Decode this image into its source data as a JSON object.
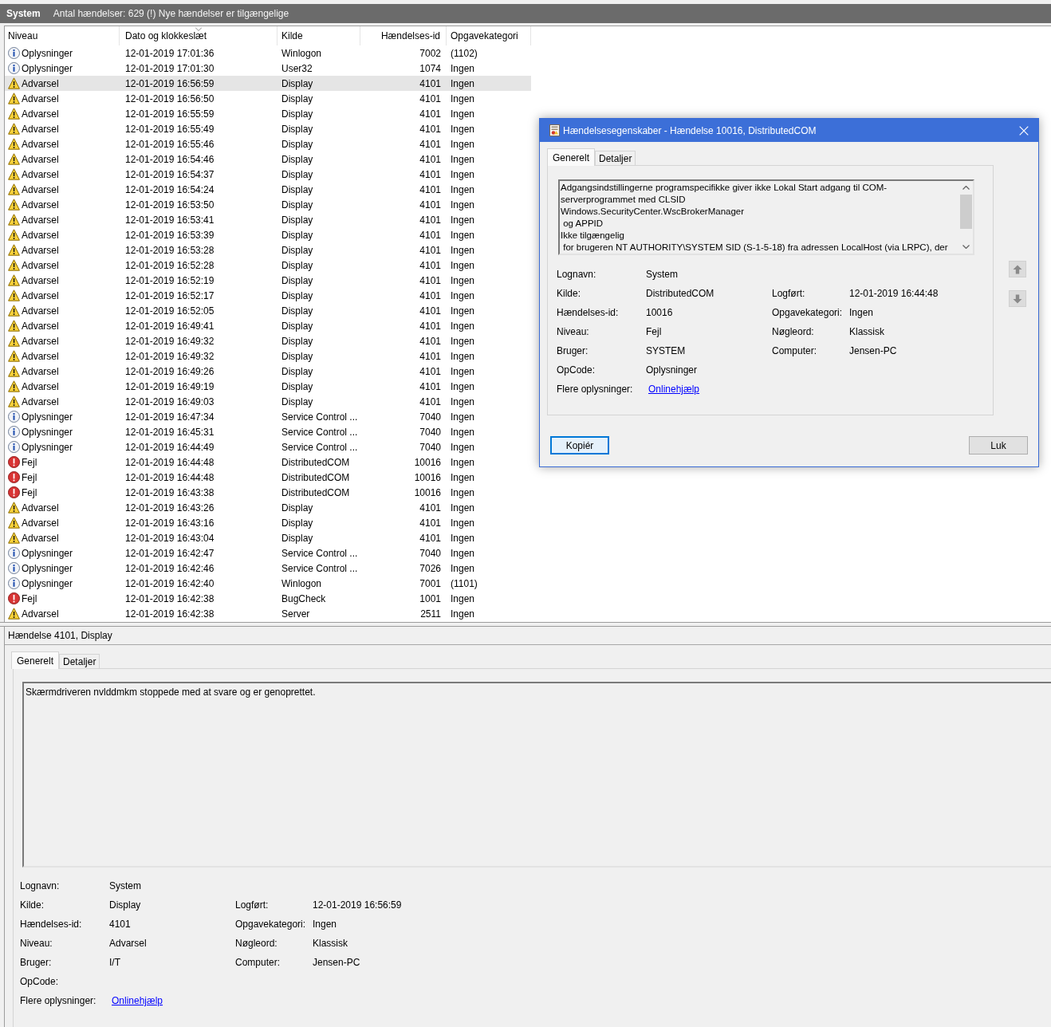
{
  "header_bar": {
    "title": "System",
    "summary": "Antal hændelser: 629 (!) Nye hændelser er tilgængelige"
  },
  "table": {
    "columns": [
      {
        "label": "Niveau",
        "sorted": false
      },
      {
        "label": "Dato og klokkeslæt",
        "sorted": true
      },
      {
        "label": "Kilde",
        "sorted": false
      },
      {
        "label": "Hændelses-id",
        "sorted": false
      },
      {
        "label": "Opgavekategori",
        "sorted": false
      }
    ],
    "rows": [
      {
        "kind": "info",
        "severity": "Oplysninger",
        "date": "12-01-2019 17:01:36",
        "source": "Winlogon",
        "event_id": "7002",
        "task_category": "(1102)",
        "selected": false
      },
      {
        "kind": "info",
        "severity": "Oplysninger",
        "date": "12-01-2019 17:01:30",
        "source": "User32",
        "event_id": "1074",
        "task_category": "Ingen",
        "selected": false
      },
      {
        "kind": "warning",
        "severity": "Advarsel",
        "date": "12-01-2019 16:56:59",
        "source": "Display",
        "event_id": "4101",
        "task_category": "Ingen",
        "selected": true
      },
      {
        "kind": "warning",
        "severity": "Advarsel",
        "date": "12-01-2019 16:56:50",
        "source": "Display",
        "event_id": "4101",
        "task_category": "Ingen",
        "selected": false
      },
      {
        "kind": "warning",
        "severity": "Advarsel",
        "date": "12-01-2019 16:55:59",
        "source": "Display",
        "event_id": "4101",
        "task_category": "Ingen",
        "selected": false
      },
      {
        "kind": "warning",
        "severity": "Advarsel",
        "date": "12-01-2019 16:55:49",
        "source": "Display",
        "event_id": "4101",
        "task_category": "Ingen",
        "selected": false
      },
      {
        "kind": "warning",
        "severity": "Advarsel",
        "date": "12-01-2019 16:55:46",
        "source": "Display",
        "event_id": "4101",
        "task_category": "Ingen",
        "selected": false
      },
      {
        "kind": "warning",
        "severity": "Advarsel",
        "date": "12-01-2019 16:54:46",
        "source": "Display",
        "event_id": "4101",
        "task_category": "Ingen",
        "selected": false
      },
      {
        "kind": "warning",
        "severity": "Advarsel",
        "date": "12-01-2019 16:54:37",
        "source": "Display",
        "event_id": "4101",
        "task_category": "Ingen",
        "selected": false
      },
      {
        "kind": "warning",
        "severity": "Advarsel",
        "date": "12-01-2019 16:54:24",
        "source": "Display",
        "event_id": "4101",
        "task_category": "Ingen",
        "selected": false
      },
      {
        "kind": "warning",
        "severity": "Advarsel",
        "date": "12-01-2019 16:53:50",
        "source": "Display",
        "event_id": "4101",
        "task_category": "Ingen",
        "selected": false
      },
      {
        "kind": "warning",
        "severity": "Advarsel",
        "date": "12-01-2019 16:53:41",
        "source": "Display",
        "event_id": "4101",
        "task_category": "Ingen",
        "selected": false
      },
      {
        "kind": "warning",
        "severity": "Advarsel",
        "date": "12-01-2019 16:53:39",
        "source": "Display",
        "event_id": "4101",
        "task_category": "Ingen",
        "selected": false
      },
      {
        "kind": "warning",
        "severity": "Advarsel",
        "date": "12-01-2019 16:53:28",
        "source": "Display",
        "event_id": "4101",
        "task_category": "Ingen",
        "selected": false
      },
      {
        "kind": "warning",
        "severity": "Advarsel",
        "date": "12-01-2019 16:52:28",
        "source": "Display",
        "event_id": "4101",
        "task_category": "Ingen",
        "selected": false
      },
      {
        "kind": "warning",
        "severity": "Advarsel",
        "date": "12-01-2019 16:52:19",
        "source": "Display",
        "event_id": "4101",
        "task_category": "Ingen",
        "selected": false
      },
      {
        "kind": "warning",
        "severity": "Advarsel",
        "date": "12-01-2019 16:52:17",
        "source": "Display",
        "event_id": "4101",
        "task_category": "Ingen",
        "selected": false
      },
      {
        "kind": "warning",
        "severity": "Advarsel",
        "date": "12-01-2019 16:52:05",
        "source": "Display",
        "event_id": "4101",
        "task_category": "Ingen",
        "selected": false
      },
      {
        "kind": "warning",
        "severity": "Advarsel",
        "date": "12-01-2019 16:49:41",
        "source": "Display",
        "event_id": "4101",
        "task_category": "Ingen",
        "selected": false
      },
      {
        "kind": "warning",
        "severity": "Advarsel",
        "date": "12-01-2019 16:49:32",
        "source": "Display",
        "event_id": "4101",
        "task_category": "Ingen",
        "selected": false
      },
      {
        "kind": "warning",
        "severity": "Advarsel",
        "date": "12-01-2019 16:49:32",
        "source": "Display",
        "event_id": "4101",
        "task_category": "Ingen",
        "selected": false
      },
      {
        "kind": "warning",
        "severity": "Advarsel",
        "date": "12-01-2019 16:49:26",
        "source": "Display",
        "event_id": "4101",
        "task_category": "Ingen",
        "selected": false
      },
      {
        "kind": "warning",
        "severity": "Advarsel",
        "date": "12-01-2019 16:49:19",
        "source": "Display",
        "event_id": "4101",
        "task_category": "Ingen",
        "selected": false
      },
      {
        "kind": "warning",
        "severity": "Advarsel",
        "date": "12-01-2019 16:49:03",
        "source": "Display",
        "event_id": "4101",
        "task_category": "Ingen",
        "selected": false
      },
      {
        "kind": "info",
        "severity": "Oplysninger",
        "date": "12-01-2019 16:47:34",
        "source": "Service Control ...",
        "event_id": "7040",
        "task_category": "Ingen",
        "selected": false
      },
      {
        "kind": "info",
        "severity": "Oplysninger",
        "date": "12-01-2019 16:45:31",
        "source": "Service Control ...",
        "event_id": "7040",
        "task_category": "Ingen",
        "selected": false
      },
      {
        "kind": "info",
        "severity": "Oplysninger",
        "date": "12-01-2019 16:44:49",
        "source": "Service Control ...",
        "event_id": "7040",
        "task_category": "Ingen",
        "selected": false
      },
      {
        "kind": "error",
        "severity": "Fejl",
        "date": "12-01-2019 16:44:48",
        "source": "DistributedCOM",
        "event_id": "10016",
        "task_category": "Ingen",
        "selected": false
      },
      {
        "kind": "error",
        "severity": "Fejl",
        "date": "12-01-2019 16:44:48",
        "source": "DistributedCOM",
        "event_id": "10016",
        "task_category": "Ingen",
        "selected": false
      },
      {
        "kind": "error",
        "severity": "Fejl",
        "date": "12-01-2019 16:43:38",
        "source": "DistributedCOM",
        "event_id": "10016",
        "task_category": "Ingen",
        "selected": false
      },
      {
        "kind": "warning",
        "severity": "Advarsel",
        "date": "12-01-2019 16:43:26",
        "source": "Display",
        "event_id": "4101",
        "task_category": "Ingen",
        "selected": false
      },
      {
        "kind": "warning",
        "severity": "Advarsel",
        "date": "12-01-2019 16:43:16",
        "source": "Display",
        "event_id": "4101",
        "task_category": "Ingen",
        "selected": false
      },
      {
        "kind": "warning",
        "severity": "Advarsel",
        "date": "12-01-2019 16:43:04",
        "source": "Display",
        "event_id": "4101",
        "task_category": "Ingen",
        "selected": false
      },
      {
        "kind": "info",
        "severity": "Oplysninger",
        "date": "12-01-2019 16:42:47",
        "source": "Service Control ...",
        "event_id": "7040",
        "task_category": "Ingen",
        "selected": false
      },
      {
        "kind": "info",
        "severity": "Oplysninger",
        "date": "12-01-2019 16:42:46",
        "source": "Service Control ...",
        "event_id": "7026",
        "task_category": "Ingen",
        "selected": false
      },
      {
        "kind": "info",
        "severity": "Oplysninger",
        "date": "12-01-2019 16:42:40",
        "source": "Winlogon",
        "event_id": "7001",
        "task_category": "(1101)",
        "selected": false
      },
      {
        "kind": "error",
        "severity": "Fejl",
        "date": "12-01-2019 16:42:38",
        "source": "BugCheck",
        "event_id": "1001",
        "task_category": "Ingen",
        "selected": false
      },
      {
        "kind": "warning",
        "severity": "Advarsel",
        "date": "12-01-2019 16:42:38",
        "source": "Server",
        "event_id": "2511",
        "task_category": "Ingen",
        "selected": false
      }
    ]
  },
  "details_pane": {
    "title": "Hændelse 4101, Display",
    "tabs": [
      {
        "label": "Generelt",
        "selected": true
      },
      {
        "label": "Detaljer",
        "selected": false
      }
    ],
    "message": "Skærmdriveren nvlddmkm stoppede med at svare og er genoprettet.",
    "field_rows": [
      {
        "pairs": [
          {
            "label": "Lognavn:",
            "value": "System"
          }
        ]
      },
      {
        "pairs": [
          {
            "label": "Kilde:",
            "value": "Display"
          },
          {
            "label": "Logført:",
            "value": "12-01-2019 16:56:59"
          }
        ]
      },
      {
        "pairs": [
          {
            "label": "Hændelses-id:",
            "value": "4101"
          },
          {
            "label": "Opgavekategori:",
            "value": "Ingen"
          }
        ]
      },
      {
        "pairs": [
          {
            "label": "Niveau:",
            "value": "Advarsel"
          },
          {
            "label": "Nøgleord:",
            "value": "Klassisk"
          }
        ]
      },
      {
        "pairs": [
          {
            "label": "Bruger:",
            "value": "I/T"
          },
          {
            "label": "Computer:",
            "value": "Jensen-PC"
          }
        ]
      },
      {
        "pairs": [
          {
            "label": "OpCode:"
          }
        ]
      },
      {
        "pairs": [
          {
            "label": "Flere oplysninger:",
            "link": "Onlinehjælp"
          }
        ]
      }
    ]
  },
  "dialog": {
    "title": "Hændelsesegenskaber - Hændelse 10016, DistributedCOM",
    "tabs": [
      {
        "label": "Generelt",
        "selected": true
      },
      {
        "label": "Detaljer",
        "selected": false
      }
    ],
    "message_lines": [
      "Adgangsindstillingerne programspecifikke giver ikke Lokal Start adgang til COM-",
      "serverprogrammet med CLSID",
      "Windows.SecurityCenter.WscBrokerManager",
      " og APPID",
      "Ikke tilgængelig",
      " for brugeren NT AUTHORITY\\SYSTEM SID (S-1-5-18) fra adressen LocalHost (via LRPC), der"
    ],
    "field_rows": [
      {
        "pairs": [
          {
            "label": "Lognavn:",
            "value": "System"
          }
        ]
      },
      {
        "pairs": [
          {
            "label": "Kilde:",
            "value": "DistributedCOM"
          },
          {
            "label": "Logført:",
            "value": "12-01-2019 16:44:48"
          }
        ]
      },
      {
        "pairs": [
          {
            "label": "Hændelses-id:",
            "value": "10016"
          },
          {
            "label": "Opgavekategori:",
            "value": "Ingen"
          }
        ]
      },
      {
        "pairs": [
          {
            "label": "Niveau:",
            "value": "Fejl"
          },
          {
            "label": "Nøgleord:",
            "value": "Klassisk"
          }
        ]
      },
      {
        "pairs": [
          {
            "label": "Bruger:",
            "value": "SYSTEM"
          },
          {
            "label": "Computer:",
            "value": "Jensen-PC"
          }
        ]
      },
      {
        "pairs": [
          {
            "label": "OpCode:",
            "value": "Oplysninger"
          }
        ]
      },
      {
        "pairs": [
          {
            "label": "Flere oplysninger:",
            "link": "Onlinehjælp"
          }
        ]
      }
    ],
    "buttons": [
      {
        "label": "Kopiér",
        "focused": true
      },
      {
        "label": "Luk",
        "focused": false
      }
    ]
  }
}
